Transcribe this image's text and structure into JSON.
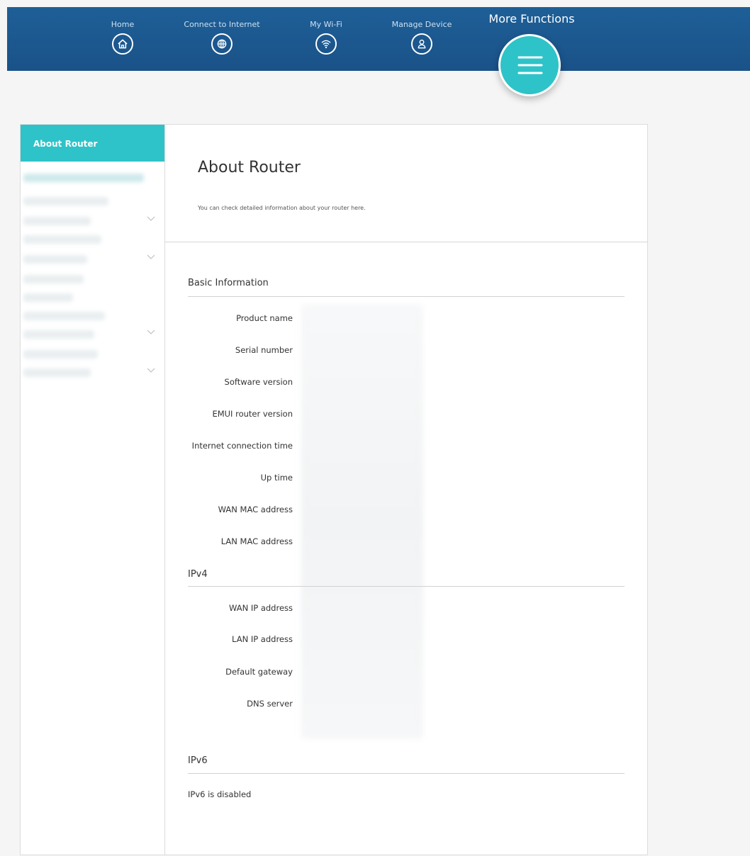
{
  "nav": {
    "items": [
      {
        "label": "Home",
        "icon": "home-icon"
      },
      {
        "label": "Connect to Internet",
        "icon": "globe-icon"
      },
      {
        "label": "My Wi-Fi",
        "icon": "wifi-icon"
      },
      {
        "label": "Manage Device",
        "icon": "user-icon"
      }
    ],
    "more": {
      "label": "More Functions",
      "icon": "menu-icon"
    }
  },
  "colors": {
    "nav_bar": "#1a5288",
    "accent": "#2ec3c8",
    "background": "#f5f5f5"
  },
  "sidebar": {
    "active_item": "About Router",
    "blurred_items_count": 6
  },
  "main": {
    "title": "About Router",
    "description": "You can check detailed information about your router here.",
    "sections": {
      "basic": {
        "title": "Basic Information",
        "labels": [
          "Product name",
          "Serial number",
          "Software version",
          "EMUI router version",
          "Internet connection time",
          "Up time",
          "WAN MAC address",
          "LAN MAC address"
        ]
      },
      "ipv4": {
        "title": "IPv4",
        "labels": [
          "WAN IP address",
          "LAN IP address",
          "Default gateway",
          "DNS server"
        ]
      },
      "ipv6": {
        "title": "IPv6",
        "status": "IPv6 is disabled"
      }
    }
  }
}
